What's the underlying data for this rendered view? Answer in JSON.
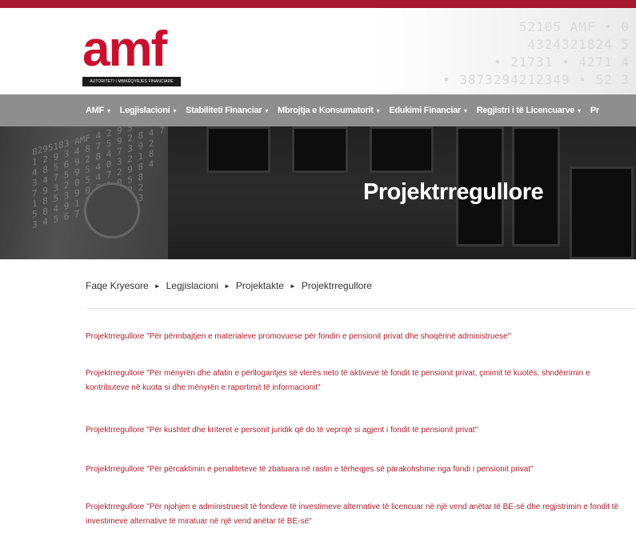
{
  "header": {
    "logo_text": "amf",
    "logo_subtitle": "AUTORITETI I MBIKËQYRJES FINANCIARE",
    "background_digits": [
      "52105 AMF • 0",
      "4324321824 5",
      "• 21731 • 4271 4",
      "• 3873294212349 • 52 3"
    ]
  },
  "nav": {
    "items": [
      {
        "label": "AMF"
      },
      {
        "label": "Legjislacioni"
      },
      {
        "label": "Stabiliteti Financiar"
      },
      {
        "label": "Mbrojtja e Konsumatorit"
      },
      {
        "label": "Edukimi Financiar"
      },
      {
        "label": "Regjistri i të Licencuarve"
      },
      {
        "label": "Pr"
      }
    ]
  },
  "hero": {
    "title": "Projektrregullore"
  },
  "breadcrumb": {
    "items": [
      "Faqe Kryesore",
      "Legjislacioni",
      "Projektakte",
      "Projektrregullore"
    ]
  },
  "documents": [
    "Projektrregullore \"Për përmbajtjen e materialeve promovuese për fondin e pensionit privat dhe shoqërinë administruese\"",
    "Projektrregullore \"Për mënyrën dhe afatin e përllogaritjes së vlerës neto të aktiveve të fondit të pensionit privat, çmimit të kuotës, shndërrimin e kontributeve në kuota si dhe mënyrën e raportimit të informacionit\"",
    "Projektrregullore \"Për kushtet dhe kriteret e personit juridik që do të veprojë si agjent i fondit të pensionit privat\"",
    "Projektrregullore \"Për përcaktimin e penaliteteve të zbatuara në rastin e tërheqjes së parakohshme nga fondi i pensionit privat\"",
    "Projektrregullore \"Për njohjen e administruesit të fondeve të investimeve alternative të licencuar në një vend anëtar të BE-së dhe regjistrimin e fondit të investimeve alternative të miratuar në një vend anëtar të BE-së\""
  ],
  "colors": {
    "brand_red": "#c8102e",
    "top_rule": "#a6192e",
    "nav_bg": "#8e8e8e",
    "link_red": "#b01e2e"
  }
}
